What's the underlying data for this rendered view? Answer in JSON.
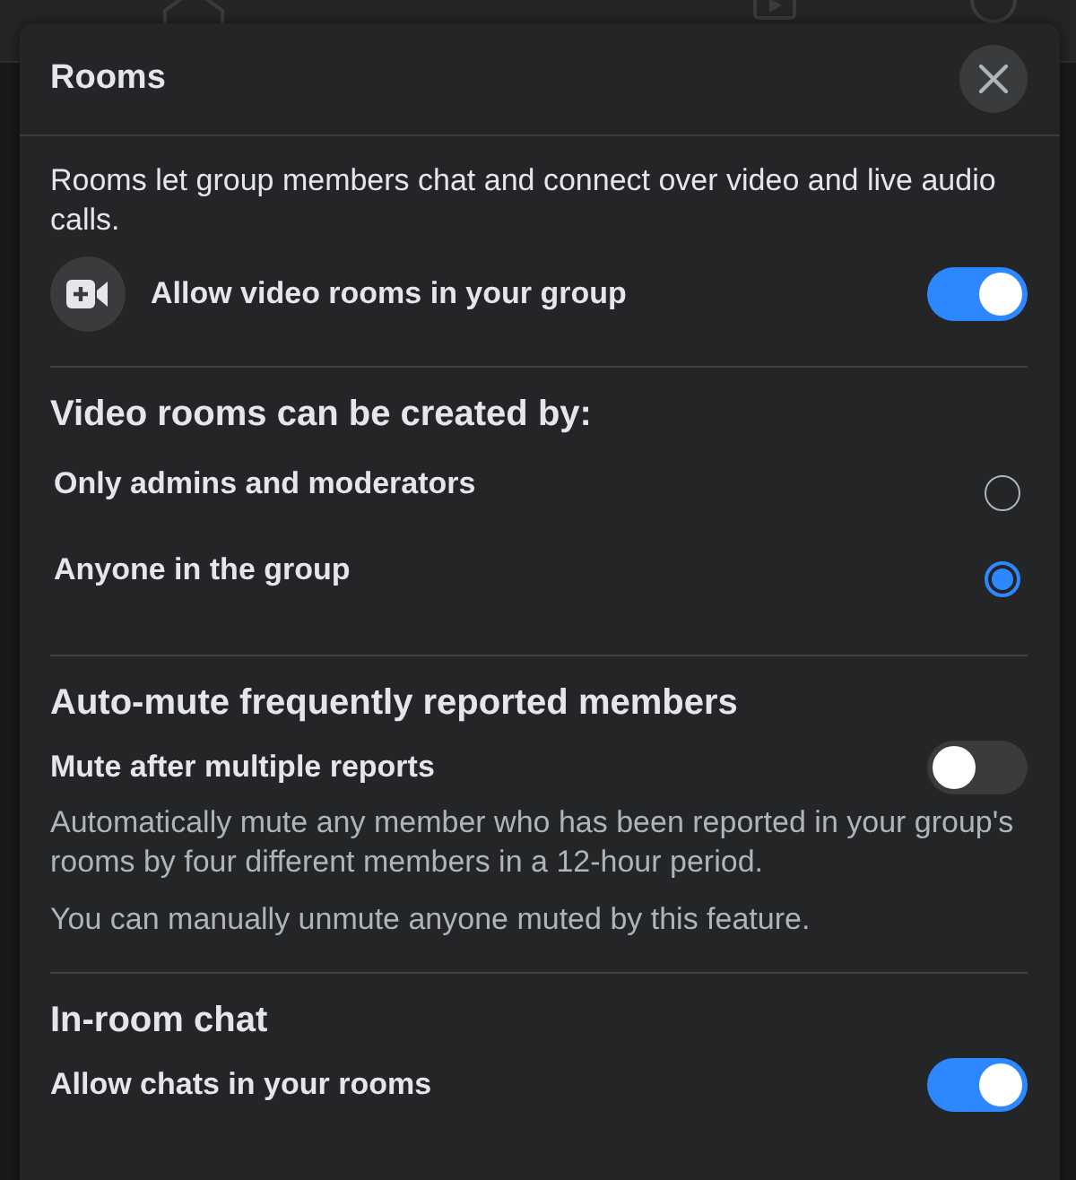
{
  "dialog": {
    "title": "Rooms"
  },
  "intro": {
    "description": "Rooms let group members chat and connect over video and live audio calls.",
    "toggle": {
      "label": "Allow video rooms in your group",
      "on": true
    }
  },
  "sections": [
    {
      "kind": "radio",
      "heading": "Video rooms can be created by:",
      "options": [
        {
          "label": "Only admins and moderators",
          "selected": false
        },
        {
          "label": "Anyone in the group",
          "selected": true
        }
      ]
    },
    {
      "kind": "toggle",
      "heading": "Auto-mute frequently reported members",
      "toggle": {
        "label": "Mute after multiple reports",
        "on": false
      },
      "notes": [
        "Automatically mute any member who has been reported in your group's rooms by four different members in a 12-hour period.",
        "You can manually unmute anyone muted by this feature."
      ]
    },
    {
      "kind": "toggle",
      "heading": "In-room chat",
      "toggle": {
        "label": "Allow chats in your rooms",
        "on": true
      }
    }
  ]
}
